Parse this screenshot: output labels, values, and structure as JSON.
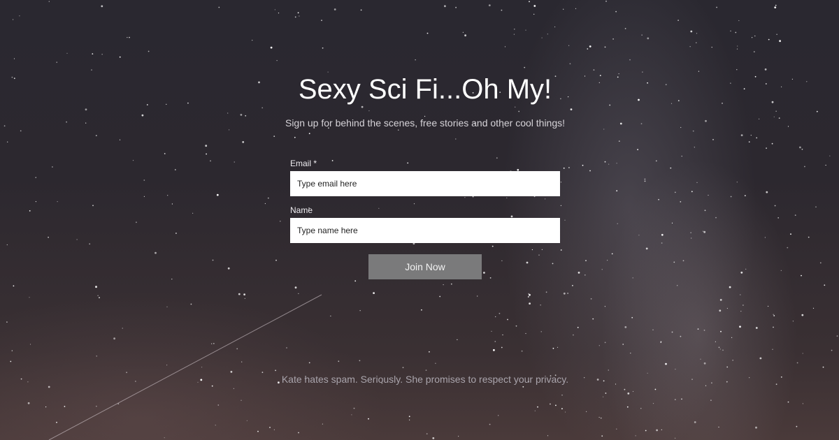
{
  "hero": {
    "title": "Sexy Sci Fi...Oh My!",
    "subtitle": "Sign up for behind the scenes, free stories and other cool things!"
  },
  "form": {
    "email_label": "Email *",
    "email_placeholder": "Type email here",
    "name_label": "Name",
    "name_placeholder": "Type name here",
    "submit_label": "Join Now"
  },
  "footer": {
    "privacy_note": "Kate hates spam. Seriously. She promises to respect your privacy."
  },
  "colors": {
    "background": "#2b272e",
    "button": "#7a7a7b",
    "field": "#ffffff",
    "title_text": "#ffffff"
  },
  "icons": [
    "starry-night-background"
  ]
}
